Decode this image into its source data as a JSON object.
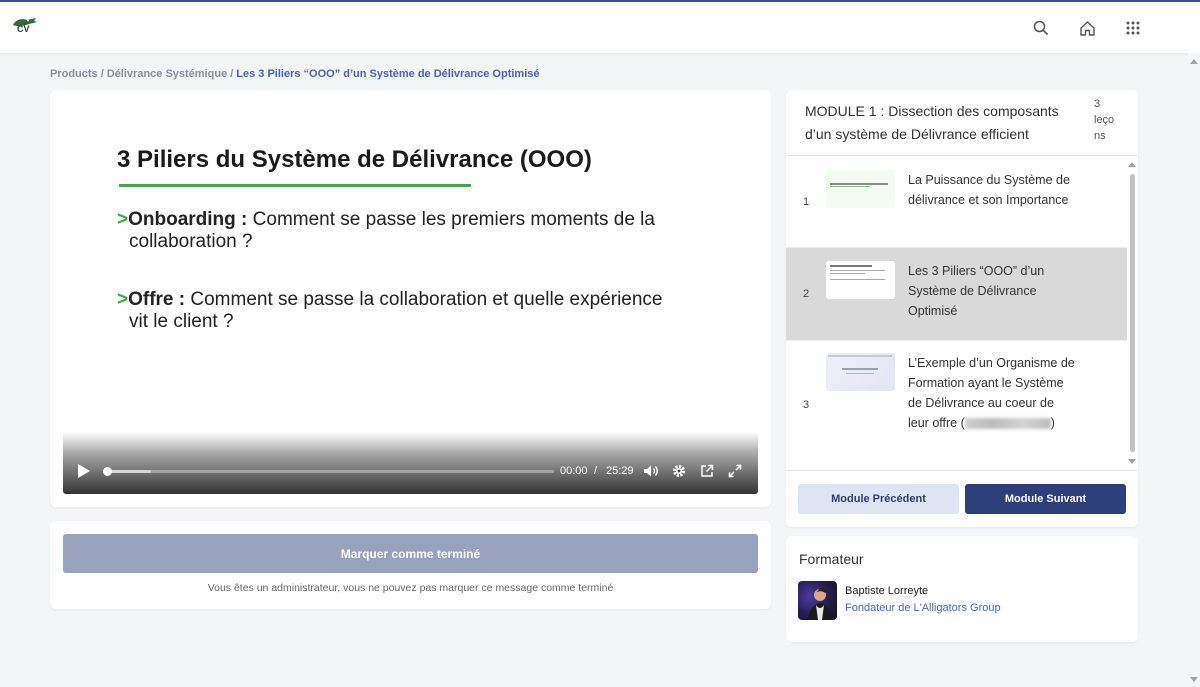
{
  "header": {
    "logo_text": "CV",
    "icons": [
      "search-icon",
      "home-icon",
      "apps-grid-icon"
    ]
  },
  "breadcrumb": {
    "items": [
      "Products",
      "Délivrance Systémique",
      "Les 3 Piliers “OOO” d’un Système de Délivrance Optimisé"
    ],
    "separator": "/"
  },
  "video": {
    "slide_title": "3 Piliers du Système de Délivrance (OOO)",
    "bullets": [
      {
        "arrow": ">",
        "bold": "Onboarding :",
        "text": " Comment se passe les premiers moments de la",
        "cont": "collaboration ?"
      },
      {
        "arrow": ">",
        "bold": "Offre :",
        "text": " Comment se passe la collaboration et quelle expérience",
        "cont": "vit le client ?"
      }
    ],
    "current_time": "00:00",
    "time_separator": "/",
    "duration": "25:29",
    "progress_fraction": 0.0
  },
  "completion": {
    "button_label": "Marquer comme terminé",
    "note": "Vous êtes un administrateur, vous ne pouvez pas marquer ce message comme terminé"
  },
  "module": {
    "title": "MODULE 1 : Dissection des composants d’un système de Délivrance efficient",
    "lesson_count_lines": [
      "3",
      "leço",
      "ns"
    ],
    "lessons": [
      {
        "number": "1",
        "title": "La Puissance du Système de délivrance et son Importance",
        "active": false
      },
      {
        "number": "2",
        "title": "Les 3 Piliers “OOO” d’un Système de Délivrance Optimisé",
        "active": true
      },
      {
        "number": "3",
        "title_prefix": "L’Exemple d’un Organisme de Formation ayant le Système de Délivrance au coeur de leur offre (",
        "title_suffix": ")",
        "active": false
      }
    ],
    "prev_label": "Module Précédent",
    "next_label": "Module Suivant"
  },
  "trainer": {
    "heading": "Formateur",
    "name": "Baptiste Lorreyte",
    "role": "Fondateur de L'Alligators Group"
  },
  "colors": {
    "accent": "#2d3f78",
    "link": "#4a67c8",
    "slide_green": "#3ca94d",
    "disabled_button": "#98a2bd"
  }
}
